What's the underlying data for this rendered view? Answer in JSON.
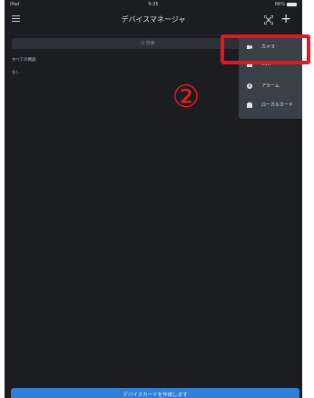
{
  "status_bar": {
    "left": "iPad",
    "center": "9:35",
    "right": "66%"
  },
  "header": {
    "title": "デバイスマネージャ",
    "add_label": "+"
  },
  "search": {
    "placeholder": "Q 検索"
  },
  "list": {
    "section_label": "すべての機器",
    "sub_label": "なし"
  },
  "annotation": {
    "number": "②"
  },
  "popup_menu": {
    "items": [
      {
        "label": "カメラ",
        "icon": "camera-icon"
      },
      {
        "label": "NVR",
        "icon": "nvr-icon"
      },
      {
        "label": "アラーム",
        "icon": "alarm-icon"
      },
      {
        "label": "ローカルカード",
        "icon": "local-card-icon"
      }
    ]
  },
  "footer": {
    "create_label": "デバイスカードを作成します"
  },
  "colors": {
    "background": "#1c1d21",
    "popup": "#3b3f47",
    "accent": "#2f7fd6",
    "highlight": "#e8151c"
  }
}
